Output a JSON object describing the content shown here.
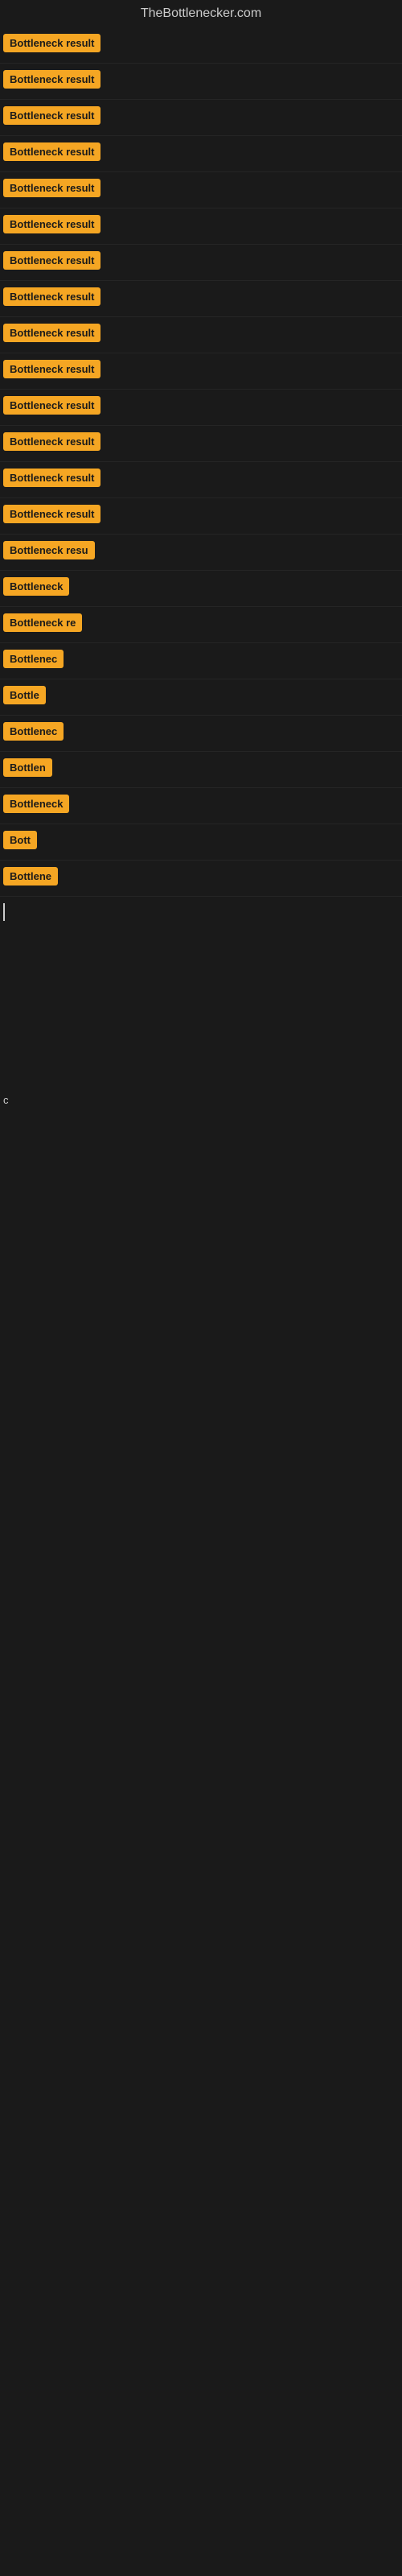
{
  "site": {
    "title": "TheBottlenecker.com"
  },
  "rows": [
    {
      "id": 1,
      "text": "Bottleneck result",
      "width": 155,
      "visible": true
    },
    {
      "id": 2,
      "text": "Bottleneck result",
      "width": 155,
      "visible": true
    },
    {
      "id": 3,
      "text": "Bottleneck result",
      "width": 155,
      "visible": true
    },
    {
      "id": 4,
      "text": "Bottleneck result",
      "width": 155,
      "visible": true
    },
    {
      "id": 5,
      "text": "Bottleneck result",
      "width": 155,
      "visible": true
    },
    {
      "id": 6,
      "text": "Bottleneck result",
      "width": 155,
      "visible": true
    },
    {
      "id": 7,
      "text": "Bottleneck result",
      "width": 155,
      "visible": true
    },
    {
      "id": 8,
      "text": "Bottleneck result",
      "width": 155,
      "visible": true
    },
    {
      "id": 9,
      "text": "Bottleneck result",
      "width": 155,
      "visible": true
    },
    {
      "id": 10,
      "text": "Bottleneck result",
      "width": 155,
      "visible": true
    },
    {
      "id": 11,
      "text": "Bottleneck result",
      "width": 155,
      "visible": true
    },
    {
      "id": 12,
      "text": "Bottleneck result",
      "width": 155,
      "visible": true
    },
    {
      "id": 13,
      "text": "Bottleneck result",
      "width": 155,
      "visible": true
    },
    {
      "id": 14,
      "text": "Bottleneck result",
      "width": 155,
      "visible": true
    },
    {
      "id": 15,
      "text": "Bottleneck resu",
      "width": 130,
      "visible": true
    },
    {
      "id": 16,
      "text": "Bottleneck",
      "width": 90,
      "visible": true
    },
    {
      "id": 17,
      "text": "Bottleneck re",
      "width": 108,
      "visible": true
    },
    {
      "id": 18,
      "text": "Bottlenec",
      "width": 78,
      "visible": true
    },
    {
      "id": 19,
      "text": "Bottle",
      "width": 55,
      "visible": true
    },
    {
      "id": 20,
      "text": "Bottlenec",
      "width": 78,
      "visible": true
    },
    {
      "id": 21,
      "text": "Bottlen",
      "width": 62,
      "visible": true
    },
    {
      "id": 22,
      "text": "Bottleneck",
      "width": 88,
      "visible": true
    },
    {
      "id": 23,
      "text": "Bott",
      "width": 42,
      "visible": true
    },
    {
      "id": 24,
      "text": "Bottlene",
      "width": 70,
      "visible": true
    }
  ],
  "colors": {
    "tag_bg": "#f5a623",
    "tag_text": "#1a1a1a",
    "bg": "#1a1a1a",
    "title": "#cccccc"
  }
}
